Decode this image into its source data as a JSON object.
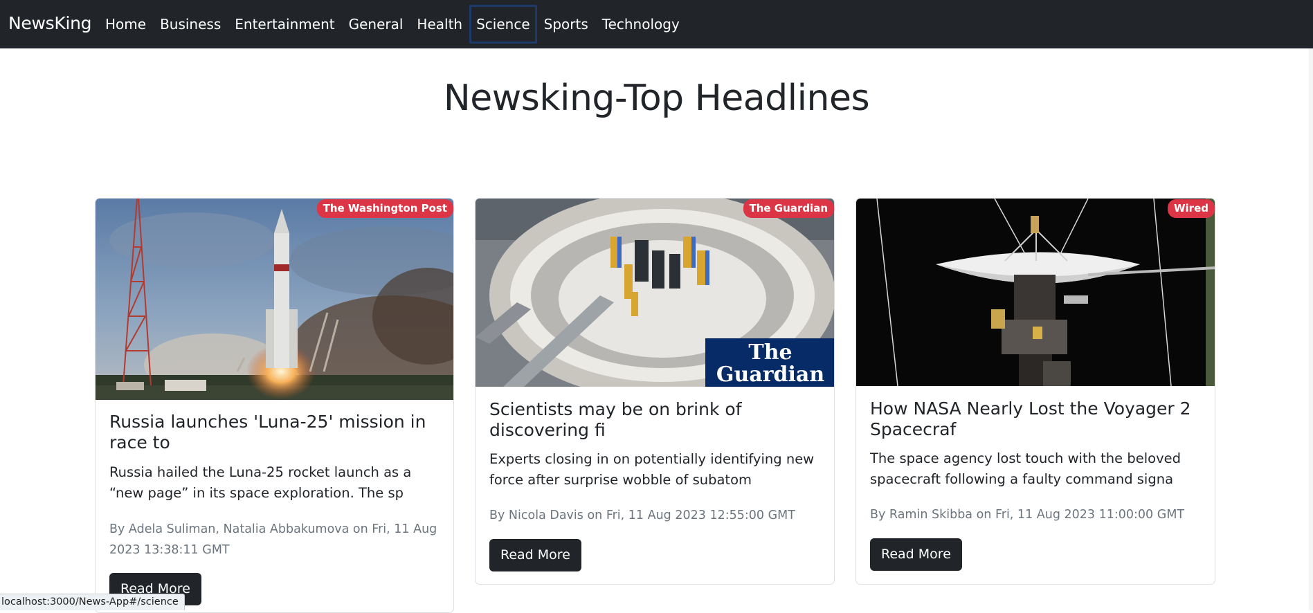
{
  "navbar": {
    "brand": "NewsKing",
    "links": [
      "Home",
      "Business",
      "Entertainment",
      "General",
      "Health",
      "Science",
      "Sports",
      "Technology"
    ],
    "active": "Science"
  },
  "page_title": "Newsking-Top Headlines",
  "cards": [
    {
      "source": "The Washington Post",
      "title": "Russia launches 'Luna-25' mission in race to",
      "description": "Russia hailed the Luna-25 rocket launch as a “new page” in its space exploration. The sp",
      "meta": "By Adela Suliman, Natalia Abbakumova on Fri, 11 Aug 2023 13:38:11 GMT",
      "button": "Read More",
      "image_icon": "rocket-launch-image"
    },
    {
      "source": "The Guardian",
      "title": "Scientists may be on brink of discovering fi",
      "description": "Experts closing in on potentially identifying new force after surprise wobble of subatom",
      "meta": "By Nicola Davis on Fri, 11 Aug 2023 12:55:00 GMT",
      "button": "Read More",
      "image_icon": "particle-lab-image",
      "image_logo": "The Guardian"
    },
    {
      "source": "Wired",
      "title": "How NASA Nearly Lost the Voyager 2 Spacecraf",
      "description": "The space agency lost touch with the beloved spacecraft following a faulty command signa",
      "meta": "By Ramin Skibba on Fri, 11 Aug 2023 11:00:00 GMT",
      "button": "Read More",
      "image_icon": "voyager-spacecraft-image"
    }
  ],
  "status_bar": "localhost:3000/News-App#/science",
  "colors": {
    "navbar_bg": "#212529",
    "badge_bg": "#dc3545",
    "button_bg": "#212529",
    "meta_text": "#6c757d"
  }
}
